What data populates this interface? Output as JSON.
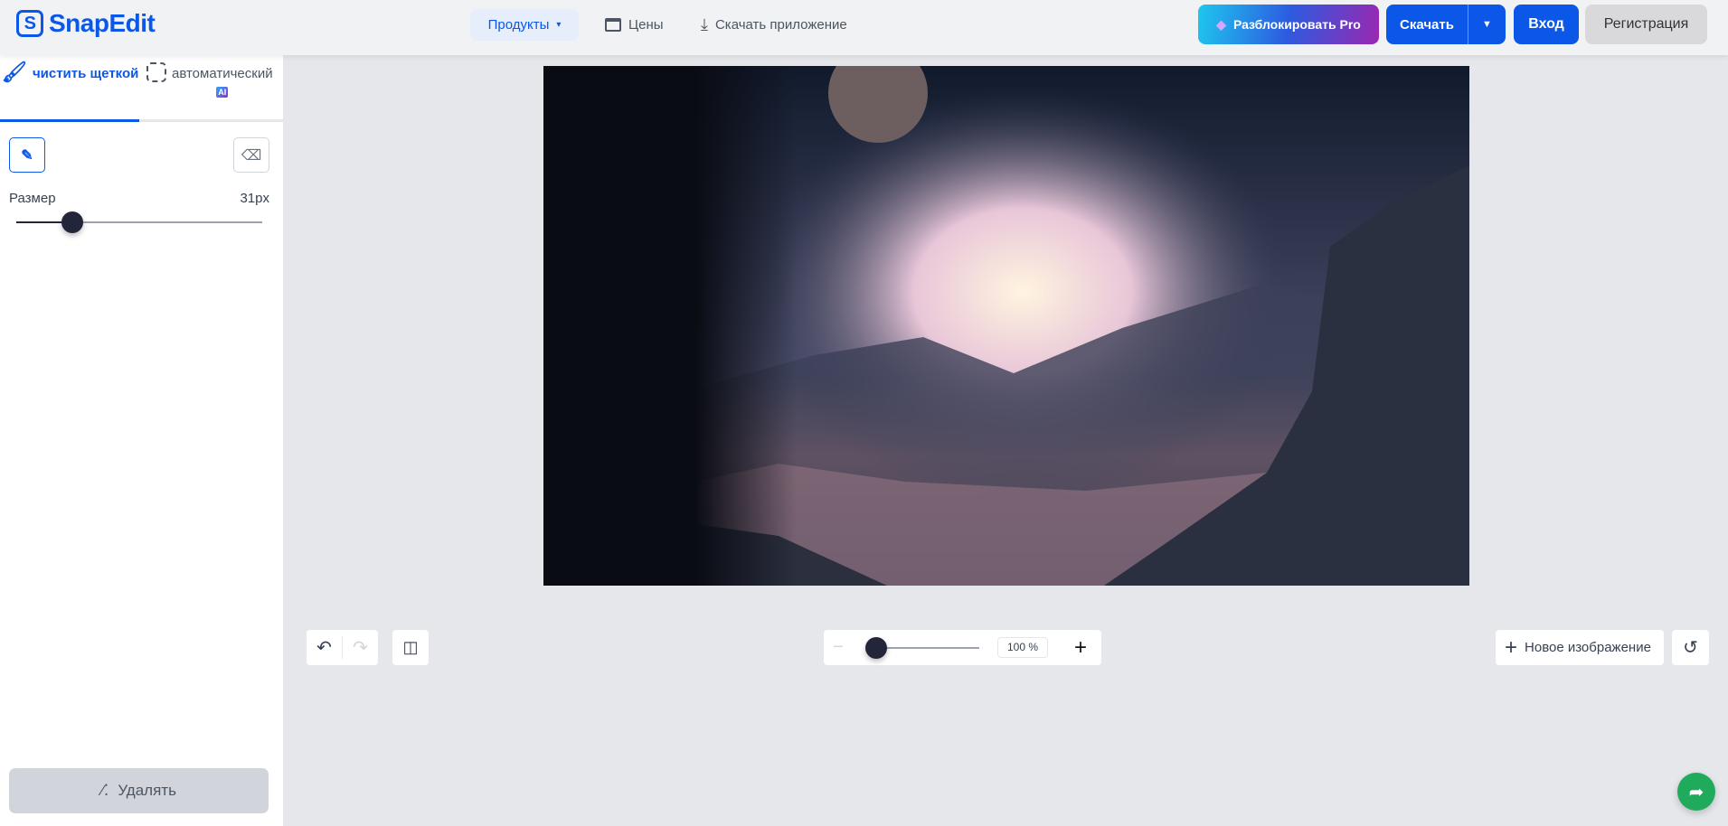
{
  "header": {
    "logo": "SnapEdit",
    "nav": [
      {
        "label": "Продукты",
        "icon": "chevron-down-icon"
      },
      {
        "label": "Цены",
        "icon": "pricing-icon"
      },
      {
        "label": "Скачать приложение",
        "icon": "download-icon"
      }
    ],
    "unlock_pro": "Разблокировать Pro",
    "download": "Скачать",
    "login": "Вход",
    "register": "Регистрация"
  },
  "sidebar": {
    "tabs": [
      {
        "label": "чистить щеткой",
        "active": true
      },
      {
        "label": "автоматический",
        "badge": "AI"
      }
    ],
    "size_label": "Размер",
    "size_value": "31px",
    "size_fraction": 0.23,
    "remove_button": "Удалять"
  },
  "canvas": {
    "zoom_value": "100 %",
    "zoom_fraction": 0,
    "new_image": "Новое изображение"
  },
  "colors": {
    "accent": "#0b57e8",
    "share": "#1faa5c"
  }
}
